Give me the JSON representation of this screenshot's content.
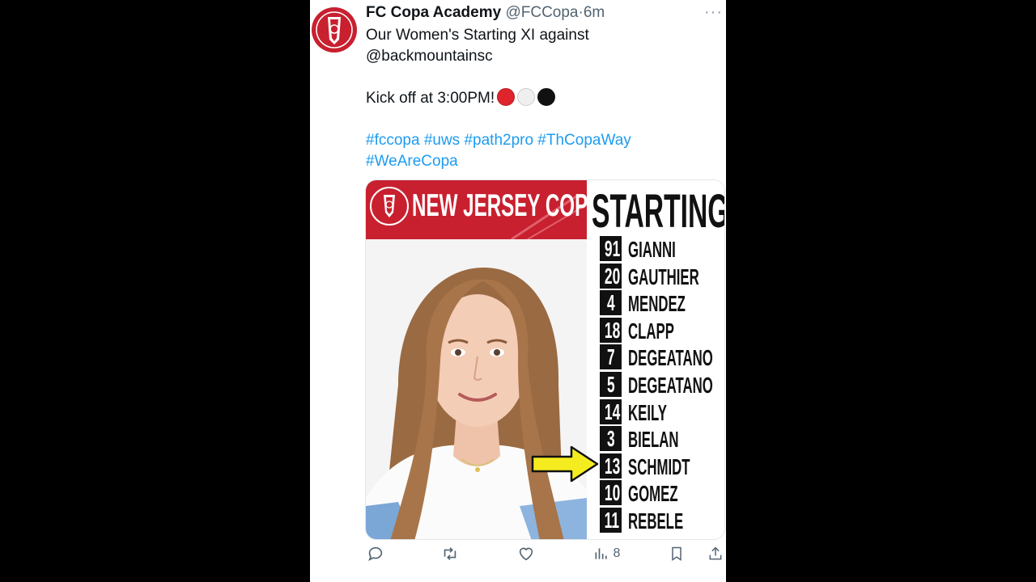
{
  "tweet": {
    "author_name": "FC Copa Academy",
    "handle": "@FCCopa",
    "separator": "·",
    "time": "6m",
    "more": "···",
    "line1": "Our Women's Starting XI against",
    "line2": "@backmountainsc",
    "kickoff": "Kick off at 3:00PM!",
    "hashtags_line1": "#fccopa #uws #path2pro #ThCopaWay",
    "hashtags_line2": "#WeAreCopa",
    "emoji_colors": [
      "#e0242b",
      "#f1f1f1",
      "#111111"
    ]
  },
  "graphic": {
    "club_name": "NEW JERSEY COPA FC",
    "title": "STARTING XI",
    "lineup": [
      {
        "number": "91",
        "name": "GIANNI"
      },
      {
        "number": "20",
        "name": "GAUTHIER"
      },
      {
        "number": "4",
        "name": "MENDEZ"
      },
      {
        "number": "18",
        "name": "CLAPP"
      },
      {
        "number": "7",
        "name": "DEGEATANO"
      },
      {
        "number": "5",
        "name": "DEGEATANO"
      },
      {
        "number": "14",
        "name": "KEILY"
      },
      {
        "number": "3",
        "name": "BIELAN"
      },
      {
        "number": "13",
        "name": "SCHMIDT"
      },
      {
        "number": "10",
        "name": "GOMEZ"
      },
      {
        "number": "11",
        "name": "REBELE"
      }
    ],
    "brand_red": "#c8202f",
    "arrow_color": "#f5ec1f"
  },
  "actions": {
    "views": "8"
  }
}
